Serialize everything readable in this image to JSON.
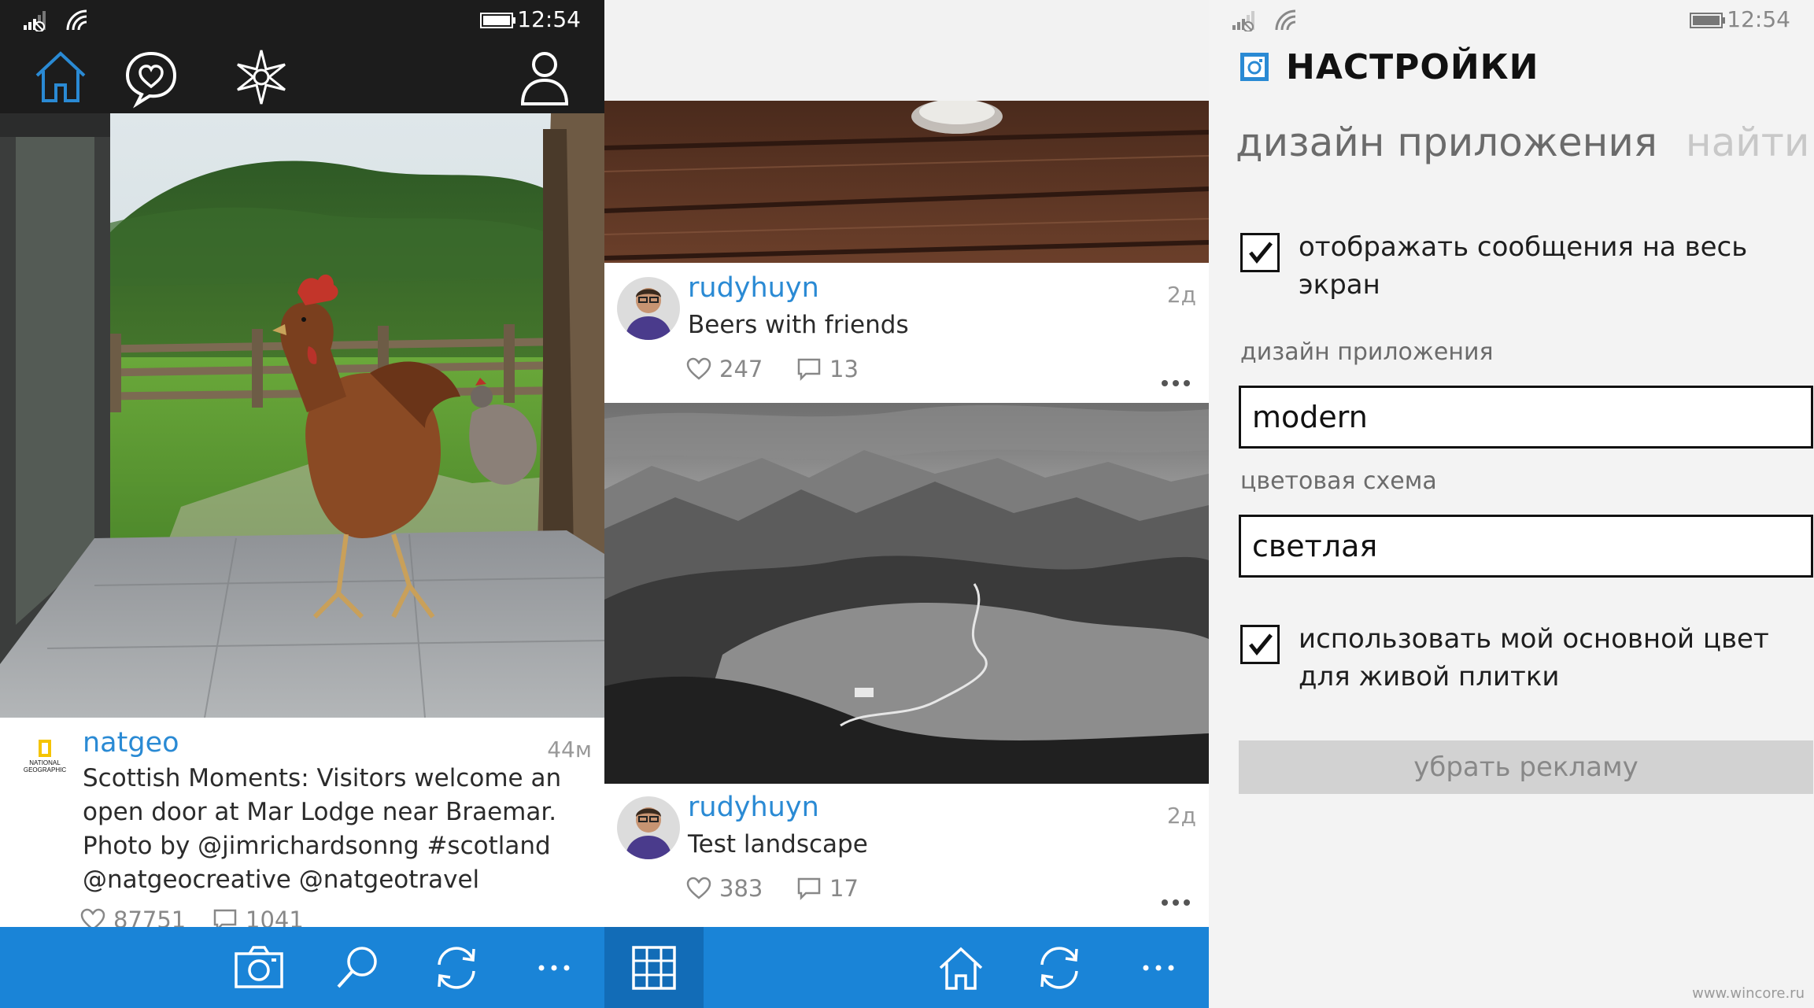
{
  "status_bar": {
    "time": "12:54"
  },
  "feed_screen": {
    "top_nav": {
      "icons": [
        "home-icon",
        "activity-heart-icon",
        "explore-compass-icon",
        "profile-icon"
      ],
      "active_color": "#2a8ad4"
    },
    "post": {
      "account_logo_text": "NATIONAL GEOGRAPHIC",
      "username": "natgeo",
      "time_ago": "44м",
      "caption_lines": [
        "Scottish Moments:  Visitors welcome an",
        "open door at Mar Lodge near Braemar.",
        "Photo by @jimrichardsonng #scotland",
        "@natgeocreative @natgeotravel"
      ],
      "likes": "87751",
      "comments": "1041"
    },
    "app_bar": {
      "icons": [
        "camera-icon",
        "search-icon",
        "refresh-icon",
        "more-icon"
      ]
    }
  },
  "grid_screen": {
    "posts": [
      {
        "username": "rudyhuyn",
        "caption": "Beers with friends",
        "time_ago": "2д",
        "likes": "247",
        "comments": "13"
      },
      {
        "username": "rudyhuyn",
        "caption": "Test landscape",
        "time_ago": "2д",
        "likes": "383",
        "comments": "17"
      }
    ],
    "app_bar": {
      "icons": [
        "grid-view-icon",
        "home-icon",
        "refresh-icon",
        "more-icon"
      ]
    }
  },
  "settings_screen": {
    "title": "НАСТРОЙКИ",
    "pivot": {
      "active": "дизайн приложения",
      "next": "найти др"
    },
    "fullscreen_messages": {
      "label": "отображать сообщения на весь экран",
      "checked": true
    },
    "app_design": {
      "label": "дизайн приложения",
      "value": "modern"
    },
    "color_scheme": {
      "label": "цветовая схема",
      "value": "светлая"
    },
    "live_tile_color": {
      "label": "использовать мой основной цвет для живой плитки",
      "checked": true
    },
    "remove_ads_button": "убрать рекламу",
    "watermark": "www.wincore.ru"
  },
  "colors": {
    "accent": "#1a84d7",
    "accent_dark": "#126cb7",
    "link": "#2a8ad4",
    "dark_bar": "#1c1c1c"
  }
}
